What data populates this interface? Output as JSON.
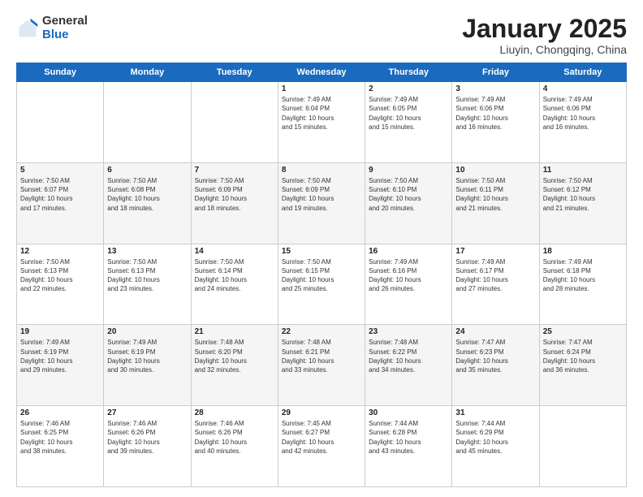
{
  "logo": {
    "general": "General",
    "blue": "Blue"
  },
  "title": "January 2025",
  "subtitle": "Liuyin, Chongqing, China",
  "days_header": [
    "Sunday",
    "Monday",
    "Tuesday",
    "Wednesday",
    "Thursday",
    "Friday",
    "Saturday"
  ],
  "weeks": [
    [
      {
        "day": "",
        "info": ""
      },
      {
        "day": "",
        "info": ""
      },
      {
        "day": "",
        "info": ""
      },
      {
        "day": "1",
        "info": "Sunrise: 7:49 AM\nSunset: 6:04 PM\nDaylight: 10 hours\nand 15 minutes."
      },
      {
        "day": "2",
        "info": "Sunrise: 7:49 AM\nSunset: 6:05 PM\nDaylight: 10 hours\nand 15 minutes."
      },
      {
        "day": "3",
        "info": "Sunrise: 7:49 AM\nSunset: 6:06 PM\nDaylight: 10 hours\nand 16 minutes."
      },
      {
        "day": "4",
        "info": "Sunrise: 7:49 AM\nSunset: 6:06 PM\nDaylight: 10 hours\nand 16 minutes."
      }
    ],
    [
      {
        "day": "5",
        "info": "Sunrise: 7:50 AM\nSunset: 6:07 PM\nDaylight: 10 hours\nand 17 minutes."
      },
      {
        "day": "6",
        "info": "Sunrise: 7:50 AM\nSunset: 6:08 PM\nDaylight: 10 hours\nand 18 minutes."
      },
      {
        "day": "7",
        "info": "Sunrise: 7:50 AM\nSunset: 6:09 PM\nDaylight: 10 hours\nand 18 minutes."
      },
      {
        "day": "8",
        "info": "Sunrise: 7:50 AM\nSunset: 6:09 PM\nDaylight: 10 hours\nand 19 minutes."
      },
      {
        "day": "9",
        "info": "Sunrise: 7:50 AM\nSunset: 6:10 PM\nDaylight: 10 hours\nand 20 minutes."
      },
      {
        "day": "10",
        "info": "Sunrise: 7:50 AM\nSunset: 6:11 PM\nDaylight: 10 hours\nand 21 minutes."
      },
      {
        "day": "11",
        "info": "Sunrise: 7:50 AM\nSunset: 6:12 PM\nDaylight: 10 hours\nand 21 minutes."
      }
    ],
    [
      {
        "day": "12",
        "info": "Sunrise: 7:50 AM\nSunset: 6:13 PM\nDaylight: 10 hours\nand 22 minutes."
      },
      {
        "day": "13",
        "info": "Sunrise: 7:50 AM\nSunset: 6:13 PM\nDaylight: 10 hours\nand 23 minutes."
      },
      {
        "day": "14",
        "info": "Sunrise: 7:50 AM\nSunset: 6:14 PM\nDaylight: 10 hours\nand 24 minutes."
      },
      {
        "day": "15",
        "info": "Sunrise: 7:50 AM\nSunset: 6:15 PM\nDaylight: 10 hours\nand 25 minutes."
      },
      {
        "day": "16",
        "info": "Sunrise: 7:49 AM\nSunset: 6:16 PM\nDaylight: 10 hours\nand 26 minutes."
      },
      {
        "day": "17",
        "info": "Sunrise: 7:49 AM\nSunset: 6:17 PM\nDaylight: 10 hours\nand 27 minutes."
      },
      {
        "day": "18",
        "info": "Sunrise: 7:49 AM\nSunset: 6:18 PM\nDaylight: 10 hours\nand 28 minutes."
      }
    ],
    [
      {
        "day": "19",
        "info": "Sunrise: 7:49 AM\nSunset: 6:19 PM\nDaylight: 10 hours\nand 29 minutes."
      },
      {
        "day": "20",
        "info": "Sunrise: 7:49 AM\nSunset: 6:19 PM\nDaylight: 10 hours\nand 30 minutes."
      },
      {
        "day": "21",
        "info": "Sunrise: 7:48 AM\nSunset: 6:20 PM\nDaylight: 10 hours\nand 32 minutes."
      },
      {
        "day": "22",
        "info": "Sunrise: 7:48 AM\nSunset: 6:21 PM\nDaylight: 10 hours\nand 33 minutes."
      },
      {
        "day": "23",
        "info": "Sunrise: 7:48 AM\nSunset: 6:22 PM\nDaylight: 10 hours\nand 34 minutes."
      },
      {
        "day": "24",
        "info": "Sunrise: 7:47 AM\nSunset: 6:23 PM\nDaylight: 10 hours\nand 35 minutes."
      },
      {
        "day": "25",
        "info": "Sunrise: 7:47 AM\nSunset: 6:24 PM\nDaylight: 10 hours\nand 36 minutes."
      }
    ],
    [
      {
        "day": "26",
        "info": "Sunrise: 7:46 AM\nSunset: 6:25 PM\nDaylight: 10 hours\nand 38 minutes."
      },
      {
        "day": "27",
        "info": "Sunrise: 7:46 AM\nSunset: 6:26 PM\nDaylight: 10 hours\nand 39 minutes."
      },
      {
        "day": "28",
        "info": "Sunrise: 7:46 AM\nSunset: 6:26 PM\nDaylight: 10 hours\nand 40 minutes."
      },
      {
        "day": "29",
        "info": "Sunrise: 7:45 AM\nSunset: 6:27 PM\nDaylight: 10 hours\nand 42 minutes."
      },
      {
        "day": "30",
        "info": "Sunrise: 7:44 AM\nSunset: 6:28 PM\nDaylight: 10 hours\nand 43 minutes."
      },
      {
        "day": "31",
        "info": "Sunrise: 7:44 AM\nSunset: 6:29 PM\nDaylight: 10 hours\nand 45 minutes."
      },
      {
        "day": "",
        "info": ""
      }
    ]
  ]
}
